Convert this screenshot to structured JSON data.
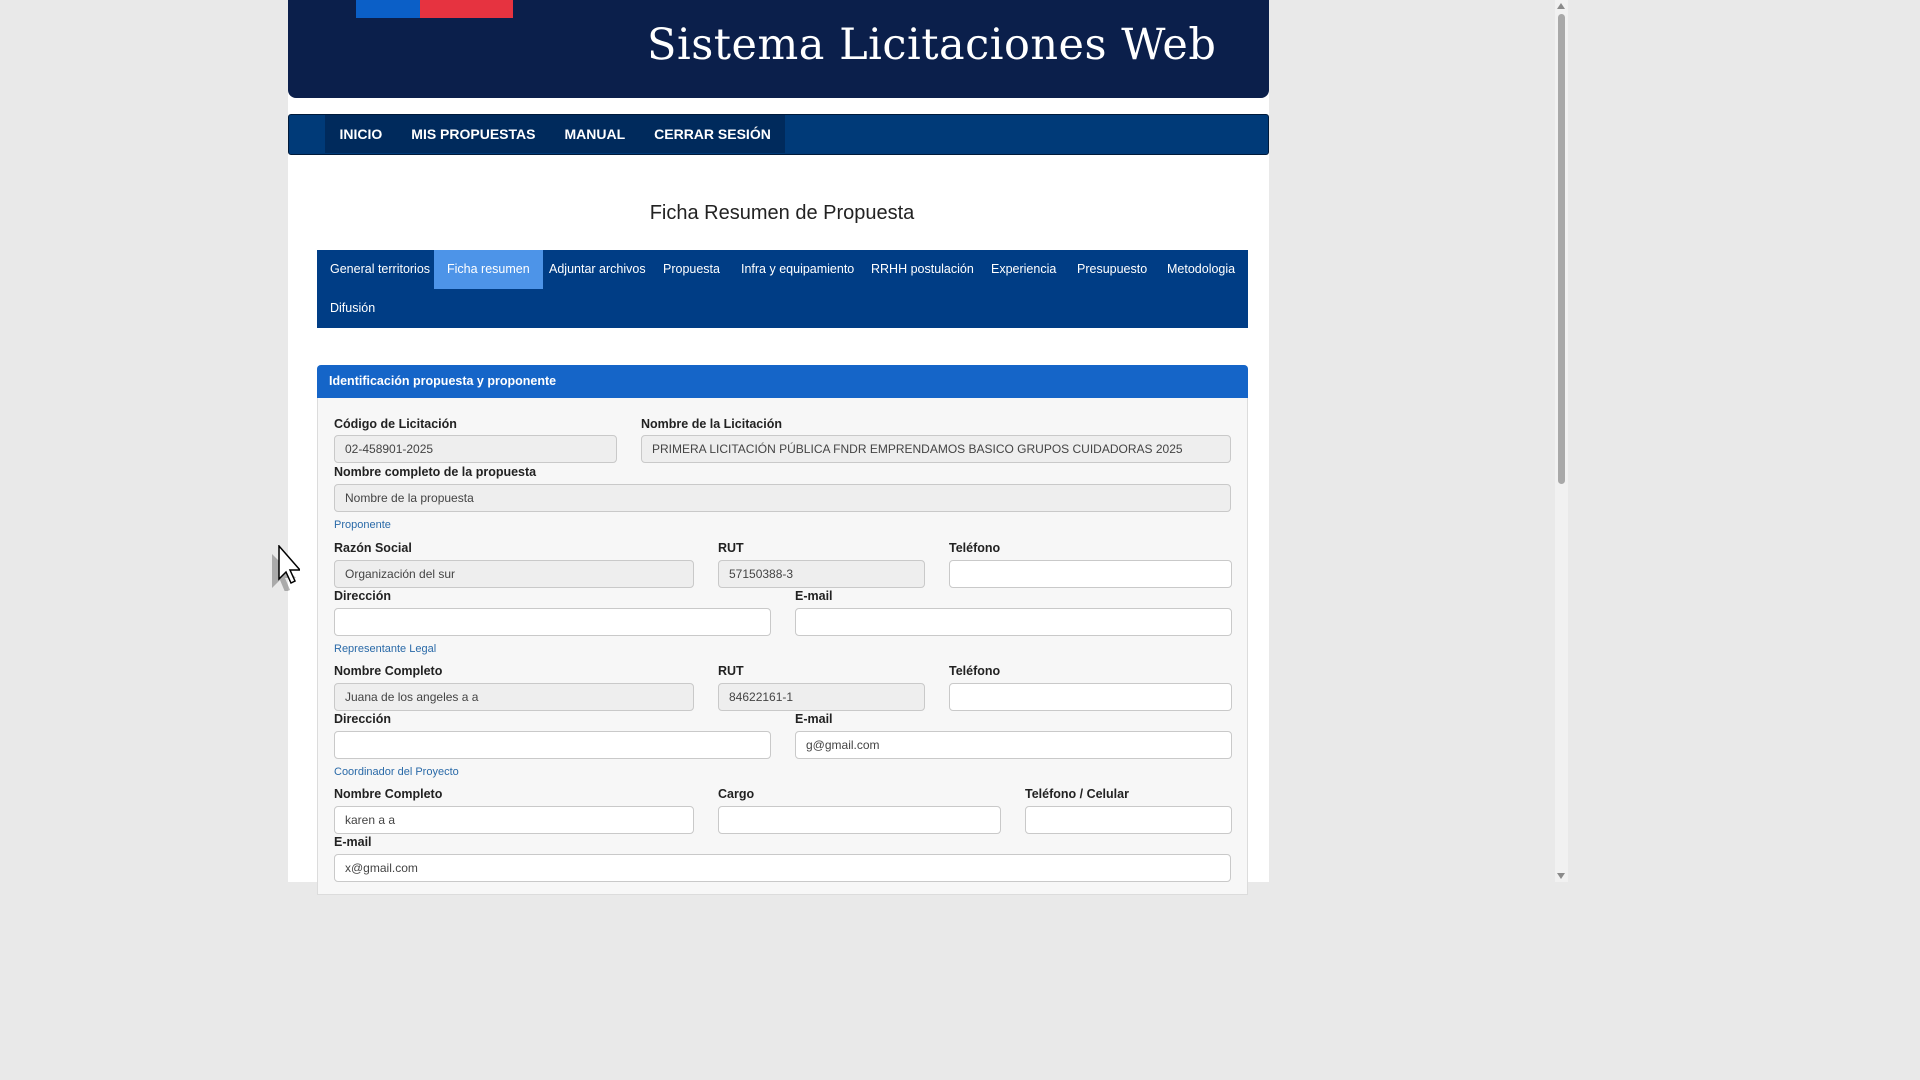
{
  "header": {
    "title": "Sistema Licitaciones Web"
  },
  "nav": [
    {
      "label": "INICIO"
    },
    {
      "label": "MIS PROPUESTAS"
    },
    {
      "label": "MANUAL"
    },
    {
      "label": "CERRAR SESIÓN"
    }
  ],
  "page_title": "Ficha Resumen de Propuesta",
  "tabs": [
    {
      "label": "General territorios"
    },
    {
      "label": "Ficha resumen"
    },
    {
      "label": "Adjuntar archivos"
    },
    {
      "label": "Propuesta"
    },
    {
      "label": "Infra y equipamiento"
    },
    {
      "label": "RRHH postulación"
    },
    {
      "label": "Experiencia"
    },
    {
      "label": "Presupuesto"
    },
    {
      "label": "Metodologia"
    },
    {
      "label": "Difusión"
    }
  ],
  "active_tab": "Ficha resumen",
  "section": {
    "title": "Identificación propuesta y proponente",
    "codigo": {
      "label": "Código de Licitación",
      "value": "02-458901-2025"
    },
    "nombre_licitacion": {
      "label": "Nombre de la Licitación",
      "value": "PRIMERA LICITACIÓN PÚBLICA FNDR EMPRENDAMOS BASICO GRUPOS CUIDADORAS 2025"
    },
    "nombre_propuesta": {
      "label": "Nombre completo de la propuesta",
      "value": "Nombre de la propuesta"
    },
    "proponente": {
      "heading": "Proponente",
      "razon_social": {
        "label": "Razón Social",
        "value": "Organización del sur"
      },
      "rut": {
        "label": "RUT",
        "value": "57150388-3"
      },
      "telefono": {
        "label": "Teléfono",
        "value": ""
      },
      "direccion": {
        "label": "Dirección",
        "value": ""
      },
      "email": {
        "label": "E-mail",
        "value": ""
      }
    },
    "representante": {
      "heading": "Representante Legal",
      "nombre": {
        "label": "Nombre Completo",
        "value": "Juana de los angeles a a"
      },
      "rut": {
        "label": "RUT",
        "value": "84622161-1"
      },
      "telefono": {
        "label": "Teléfono",
        "value": ""
      },
      "direccion": {
        "label": "Dirección",
        "value": ""
      },
      "email": {
        "label": "E-mail",
        "value": "g@gmail.com"
      }
    },
    "coordinador": {
      "heading": "Coordinador del Proyecto",
      "nombre": {
        "label": "Nombre Completo",
        "value": "karen a a"
      },
      "cargo": {
        "label": "Cargo",
        "value": ""
      },
      "telefono": {
        "label": "Teléfono / Celular",
        "value": ""
      },
      "email": {
        "label": "E-mail",
        "value": "x@gmail.com"
      }
    }
  },
  "colors": {
    "banner": "#0b1f4b",
    "nav": "#003a78",
    "tabs": "#003d85",
    "tab_active": "#4d94e8",
    "panel_header": "#1565c8"
  }
}
